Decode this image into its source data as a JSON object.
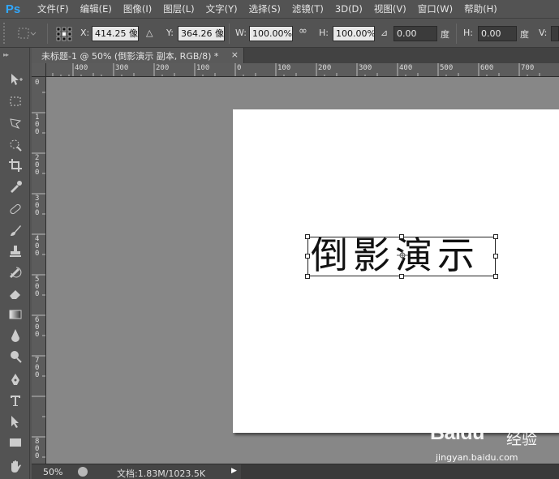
{
  "app": {
    "logo": "Ps"
  },
  "menu": [
    "文件(F)",
    "编辑(E)",
    "图像(I)",
    "图层(L)",
    "文字(Y)",
    "选择(S)",
    "滤镜(T)",
    "3D(D)",
    "视图(V)",
    "窗口(W)",
    "帮助(H)"
  ],
  "options": {
    "x_label": "X:",
    "x_value": "414.25 像",
    "delta_label": "△",
    "y_label": "Y:",
    "y_value": "364.26 像",
    "w_label": "W:",
    "w_value": "100.00%",
    "link_icon": "∞",
    "h_label": "H:",
    "h_value": "100.00%",
    "angle_icon": "⊿",
    "angle_value": "0.00",
    "angle_unit": "度",
    "hskew_label": "H:",
    "hskew_value": "0.00",
    "hskew_unit": "度",
    "v_label": "V:"
  },
  "document": {
    "tab_title": "未标题-1 @ 50% (倒影演示 副本, RGB/8) *",
    "close": "×",
    "text_content": "倒影演示"
  },
  "rulers": {
    "top": [
      "400",
      "300",
      "200",
      "100",
      "0",
      "100",
      "200",
      "300",
      "400",
      "500",
      "600",
      "700"
    ],
    "left": [
      "0",
      "1\n0\n0",
      "2\n0\n0",
      "3\n0\n0",
      "4\n0\n0",
      "5\n0\n0",
      "6\n0\n0",
      "7\n0\n0",
      "8\n0\n0"
    ]
  },
  "status": {
    "zoom": "50%",
    "doc_info": "文档:1.83M/1023.5K",
    "arrow": "▶"
  },
  "watermark": {
    "logo": "Baidu",
    "jingyan": "经验",
    "url": "jingyan.baidu.com"
  },
  "colors": {
    "ps_blue": "#31a8ff",
    "panel": "#535353",
    "canvas_bg": "#878787",
    "document_bg": "#ffffff"
  }
}
